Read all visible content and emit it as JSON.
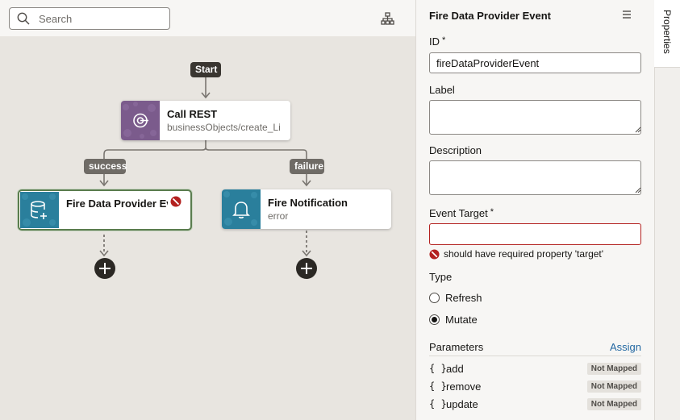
{
  "search": {
    "placeholder": "Search"
  },
  "icons": {
    "search": "search-icon",
    "layout": "diagram-layout-icon",
    "rest": "rest-call-icon",
    "data_provider": "database-event-icon",
    "notification": "bell-icon",
    "error": "error-icon",
    "add": "plus-icon",
    "menu": "hamburger-menu-icon"
  },
  "flow": {
    "start_label": "Start",
    "success_label": "success",
    "failure_label": "failure",
    "nodes": [
      {
        "title": "Call REST",
        "subtitle": "businessObjects/create_Li",
        "color": "#7b5b8c"
      },
      {
        "title": "Fire Data Provider Event",
        "subtitle": "",
        "color": "#2a7f9c",
        "has_error": true
      },
      {
        "title": "Fire Notification",
        "subtitle": "error",
        "color": "#2a7f9c"
      }
    ]
  },
  "panel": {
    "title": "Fire Data Provider Event",
    "id_label": "ID",
    "id_value": "fireDataProviderEvent",
    "required_mark": "*",
    "label_label": "Label",
    "label_value": "",
    "description_label": "Description",
    "description_value": "",
    "event_target_label": "Event Target",
    "event_target_value": "",
    "event_target_error": "should have required property 'target'",
    "type_label": "Type",
    "type_options": [
      {
        "label": "Refresh",
        "selected": false
      },
      {
        "label": "Mutate",
        "selected": true
      }
    ],
    "parameters_label": "Parameters",
    "assign_label": "Assign",
    "parameters": [
      {
        "bracket": "{ }",
        "name": "add",
        "status": "Not Mapped"
      },
      {
        "bracket": "{ }",
        "name": "remove",
        "status": "Not Mapped"
      },
      {
        "bracket": "{ }",
        "name": "update",
        "status": "Not Mapped"
      }
    ]
  },
  "rail": {
    "tab_label": "Properties"
  },
  "colors": {
    "canvas_bg": "#e8e5e0",
    "selected_border": "#5a7c4e",
    "error": "#b3211f",
    "link": "#2368a2"
  }
}
